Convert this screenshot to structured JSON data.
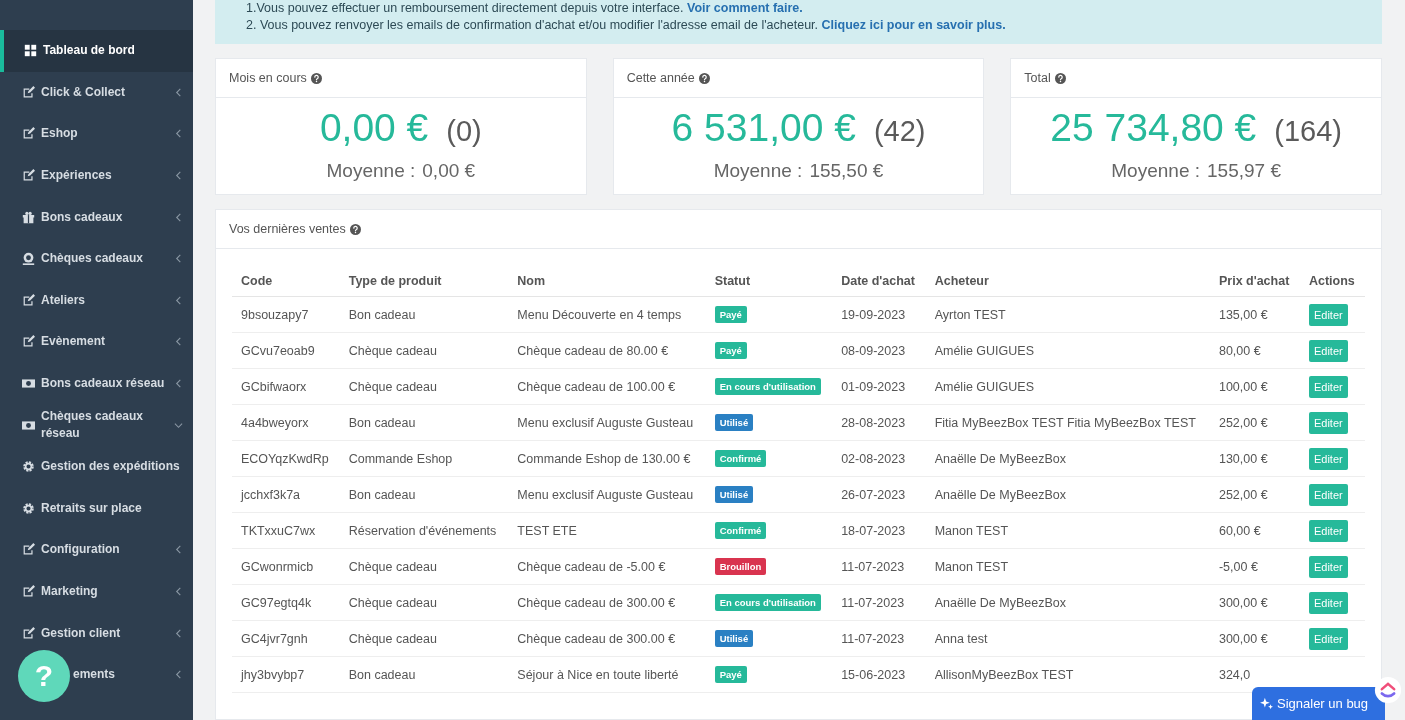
{
  "sidebar": {
    "items": [
      {
        "label": "Tableau de bord",
        "kind": "grid",
        "selected": true
      },
      {
        "label": "Click & Collect",
        "kind": "edit",
        "selected": false,
        "expanded": false
      },
      {
        "label": "Eshop",
        "kind": "edit",
        "selected": false,
        "expanded": false
      },
      {
        "label": "Expériences",
        "kind": "edit",
        "selected": false,
        "expanded": false
      },
      {
        "label": "Bons cadeaux",
        "kind": "gift",
        "selected": false,
        "expanded": false
      },
      {
        "label": "Chèques cadeaux",
        "kind": "coin",
        "selected": false,
        "expanded": false
      },
      {
        "label": "Ateliers",
        "kind": "edit",
        "selected": false,
        "expanded": false
      },
      {
        "label": "Evènement",
        "kind": "edit",
        "selected": false,
        "expanded": false
      },
      {
        "label": "Bons cadeaux réseau",
        "kind": "money",
        "selected": false,
        "expanded": false
      },
      {
        "label": "Chèques cadeaux réseau",
        "kind": "money",
        "selected": false,
        "expanded": true
      },
      {
        "label": "Gestion des expéditions",
        "kind": "gear",
        "selected": false
      },
      {
        "label": "Retraits sur place",
        "kind": "gear",
        "selected": false
      },
      {
        "label": "Configuration",
        "kind": "edit",
        "selected": false,
        "expanded": false
      },
      {
        "label": "Marketing",
        "kind": "edit",
        "selected": false,
        "expanded": false
      },
      {
        "label": "Gestion client",
        "kind": "edit",
        "selected": false,
        "expanded": false
      },
      {
        "label": "ements",
        "kind": "covered",
        "selected": false,
        "expanded": false
      }
    ]
  },
  "info": {
    "lines": [
      {
        "text": "1.Vous pouvez effectuer un remboursement directement depuis votre interface.",
        "link": "Voir comment faire."
      },
      {
        "text": "2. Vous pouvez renvoyer les emails de confirmation d'achat et/ou modifier l'adresse email de l'acheteur.",
        "link": "Cliquez ici pour en savoir plus."
      }
    ]
  },
  "stats": [
    {
      "title": "Mois en cours",
      "amount": "0,00 €",
      "count": "(0)",
      "average_label": "Moyenne :",
      "average": "0,00 €"
    },
    {
      "title": "Cette année",
      "amount": "6 531,00 €",
      "count": "(42)",
      "average_label": "Moyenne :",
      "average": "155,50 €"
    },
    {
      "title": "Total",
      "amount": "25 734,80 €",
      "count": "(164)",
      "average_label": "Moyenne :",
      "average": "155,97 €"
    }
  ],
  "sales": {
    "title": "Vos dernières ventes",
    "columns": [
      "Code",
      "Type de produit",
      "Nom",
      "Statut",
      "Date d'achat",
      "Acheteur",
      "Prix d'achat",
      "Actions"
    ],
    "rows": [
      {
        "code": "9bsouzapy7",
        "type": "Bon cadeau",
        "name": "Menu Découverte en 4 temps",
        "status": "Payé",
        "color": "#26b99a",
        "date": "19-09-2023",
        "buyer": "Ayrton TEST",
        "price": "135,00 €",
        "action": "Editer"
      },
      {
        "code": "GCvu7eoab9",
        "type": "Chèque cadeau",
        "name": "Chèque cadeau de 80.00 €",
        "status": "Payé",
        "color": "#26b99a",
        "date": "08-09-2023",
        "buyer": "Amélie GUIGUES",
        "price": "80,00 €",
        "action": "Editer"
      },
      {
        "code": "GCbifwaorx",
        "type": "Chèque cadeau",
        "name": "Chèque cadeau de 100.00 €",
        "status": "En cours d'utilisation",
        "color": "#26b99a",
        "date": "01-09-2023",
        "buyer": "Amélie GUIGUES",
        "price": "100,00 €",
        "action": "Editer"
      },
      {
        "code": "4a4bweyorx",
        "type": "Bon cadeau",
        "name": "Menu exclusif Auguste Gusteau",
        "status": "Utilisé",
        "color": "#2a80c3",
        "date": "28-08-2023",
        "buyer": "Fitia MyBeezBox TEST Fitia MyBeezBox TEST",
        "price": "252,00 €",
        "action": "Editer"
      },
      {
        "code": "ECOYqzKwdRp",
        "type": "Commande Eshop",
        "name": "Commande Eshop de 130.00 €",
        "status": "Confirmé",
        "color": "#26b99a",
        "date": "02-08-2023",
        "buyer": "Anaëlle De MyBeezBox",
        "price": "130,00 €",
        "action": "Editer"
      },
      {
        "code": "jcchxf3k7a",
        "type": "Bon cadeau",
        "name": "Menu exclusif Auguste Gusteau",
        "status": "Utilisé",
        "color": "#2a80c3",
        "date": "26-07-2023",
        "buyer": "Anaëlle De MyBeezBox",
        "price": "252,00 €",
        "action": "Editer"
      },
      {
        "code": "TKTxxuC7wx",
        "type": "Réservation d'événements",
        "name": "TEST ETE",
        "status": "Confirmé",
        "color": "#26b99a",
        "date": "18-07-2023",
        "buyer": "Manon TEST",
        "price": "60,00 €",
        "action": "Editer"
      },
      {
        "code": "GCwonrmicb",
        "type": "Chèque cadeau",
        "name": "Chèque cadeau de -5.00 €",
        "status": "Brouillon",
        "color": "#d9344f",
        "date": "11-07-2023",
        "buyer": "Manon TEST",
        "price": "-5,00 €",
        "action": "Editer"
      },
      {
        "code": "GC97egtq4k",
        "type": "Chèque cadeau",
        "name": "Chèque cadeau de 300.00 €",
        "status": "En cours d'utilisation",
        "color": "#26b99a",
        "date": "11-07-2023",
        "buyer": "Anaëlle De MyBeezBox",
        "price": "300,00 €",
        "action": "Editer"
      },
      {
        "code": "GC4jvr7gnh",
        "type": "Chèque cadeau",
        "name": "Chèque cadeau de 300.00 €",
        "status": "Utilisé",
        "color": "#2a80c3",
        "date": "11-07-2023",
        "buyer": "Anna test",
        "price": "300,00 €",
        "action": "Editer"
      },
      {
        "code": "jhy3bvybp7",
        "type": "Bon cadeau",
        "name": "Séjour à Nice en toute liberté",
        "status": "Payé",
        "color": "#26b99a",
        "date": "15-06-2023",
        "buyer": "AllisonMyBeezBox TEST",
        "price": "324,0"
      }
    ]
  },
  "help_button": {
    "label": "?"
  },
  "bug_button": {
    "label": "Signaler un bug"
  }
}
